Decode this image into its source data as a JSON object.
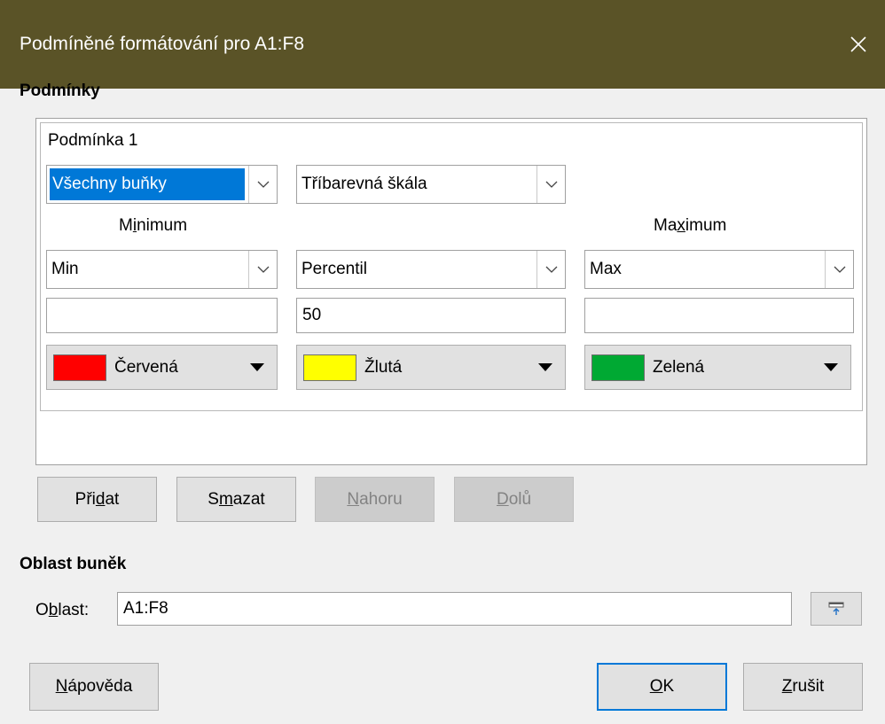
{
  "window": {
    "title": "Podmíněné formátování pro A1:F8",
    "close_icon": "close-icon"
  },
  "conditions": {
    "section_title": "Podmínky",
    "condition_label": "Podmínka 1",
    "scope_combo": {
      "value": "Všechny buňky"
    },
    "type_combo": {
      "value": "Tříbarevná škála"
    },
    "minimum": {
      "label_pre": "M",
      "label_accel": "i",
      "label_post": "nimum",
      "type": "Min",
      "value": "",
      "color_name": "Červená",
      "color": "#ff0000"
    },
    "middle": {
      "type": "Percentil",
      "value": "50",
      "color_name": "Žlutá",
      "color": "#ffff00"
    },
    "maximum": {
      "label_pre": "Ma",
      "label_accel": "x",
      "label_post": "imum",
      "type": "Max",
      "value": "",
      "color_name": "Zelená",
      "color": "#00a933"
    }
  },
  "condition_buttons": {
    "add": {
      "pre": "Při",
      "accel": "d",
      "post": "at"
    },
    "delete": {
      "pre": "S",
      "accel": "m",
      "post": "azat"
    },
    "up": {
      "pre": "",
      "accel": "N",
      "post": "ahoru"
    },
    "down": {
      "pre": "",
      "accel": "D",
      "post": "olů"
    }
  },
  "cell_range": {
    "section_title": "Oblast buněk",
    "label_pre": "O",
    "label_accel": "b",
    "label_post": "last:",
    "value": "A1:F8",
    "shrink_icon": "shrink-icon"
  },
  "footer": {
    "help": {
      "pre": "",
      "accel": "N",
      "post": "ápověda"
    },
    "ok": {
      "pre": "",
      "accel": "O",
      "post": "K"
    },
    "cancel": {
      "pre": "",
      "accel": "Z",
      "post": "rušit"
    }
  },
  "colors": {
    "titlebar": "#5a5327",
    "selection": "#0078d7"
  }
}
